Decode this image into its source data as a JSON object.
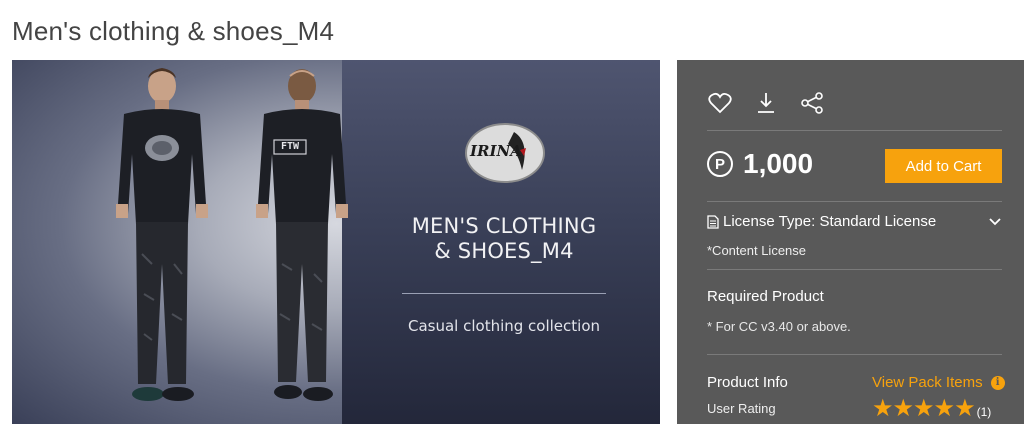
{
  "page": {
    "title": "Men's clothing & shoes_M4"
  },
  "banner": {
    "logo_text": "IRINA",
    "heading_line1": "MEN'S CLOTHING",
    "heading_line2": "& SHOES_M4",
    "subtitle": "Casual clothing collection",
    "back_shirt_print": "FTW"
  },
  "panel": {
    "icons": [
      "heart-icon",
      "download-icon",
      "share-icon"
    ],
    "currency_symbol": "P",
    "price": "1,000",
    "add_to_cart_label": "Add to Cart",
    "license_label": "License Type: Standard License",
    "license_note": "*Content License",
    "required_title": "Required Product",
    "required_note": "* For CC v3.40 or above.",
    "info_title": "Product Info",
    "pack_link_label": "View Pack Items",
    "rating_label": "User Rating",
    "rating_value": 5,
    "rating_count": "(1)"
  },
  "colors": {
    "accent": "#f7a20d",
    "panel_bg": "#595959",
    "title_text": "#444444"
  }
}
